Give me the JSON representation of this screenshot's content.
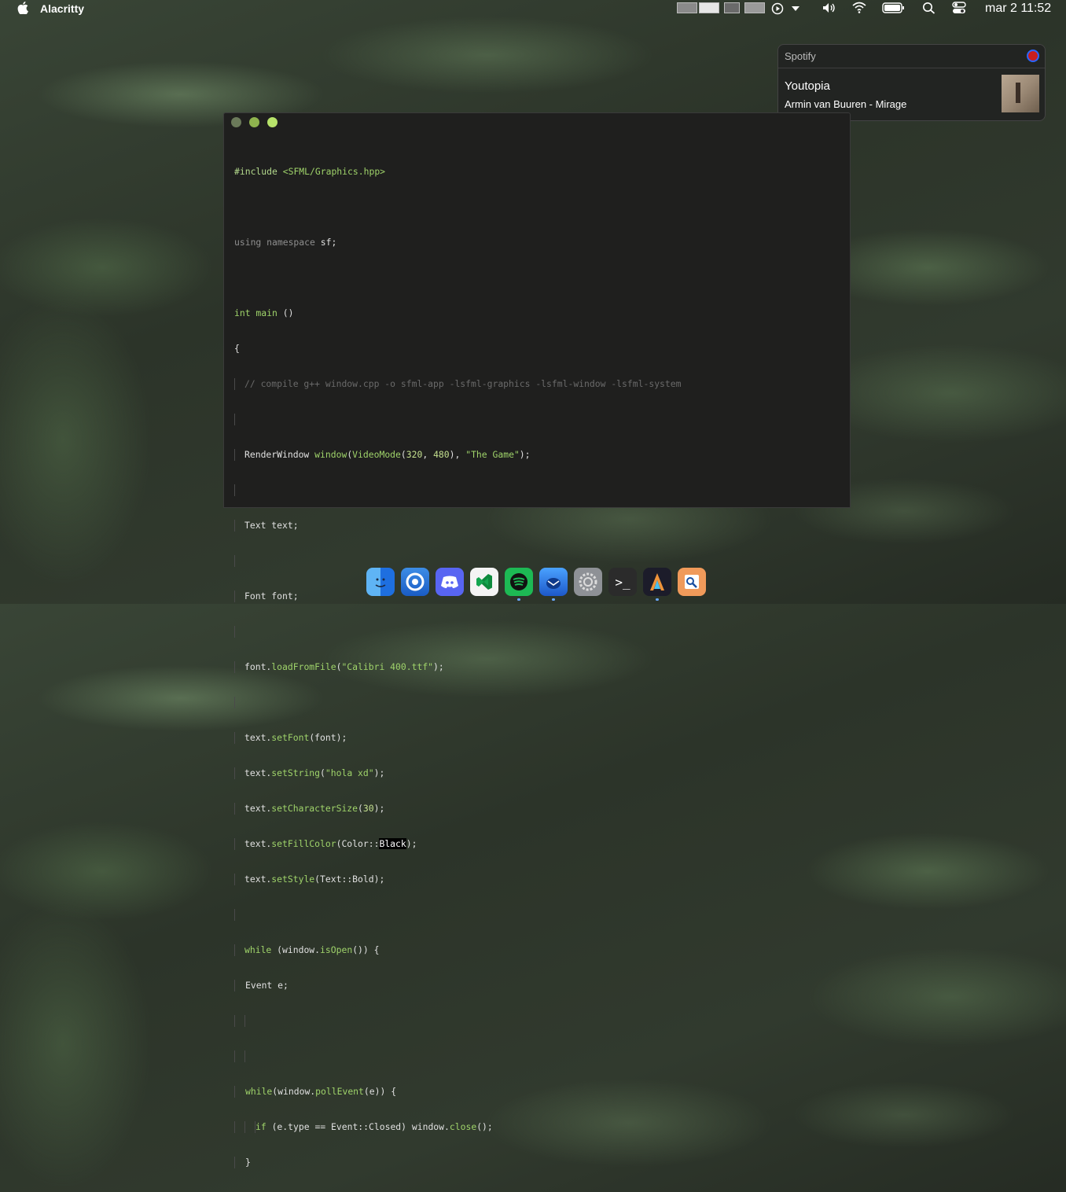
{
  "menubar": {
    "app_name": "Alacritty",
    "clock": "mar 2 11:52"
  },
  "notification": {
    "app": "Spotify",
    "title": "Youtopia",
    "body": "Armin van Buuren - Mirage"
  },
  "terminal": {
    "traffic_colors": [
      "#6b7a5a",
      "#8fb34e",
      "#b7e36a"
    ]
  },
  "code": {
    "l1a": "#include",
    "l1b": " <SFML/Graphics.hpp>",
    "l3a": "using namespace",
    "l3b": " sf;",
    "l5a": "int",
    "l5b": " main",
    "l5c": " ()",
    "l6": "{",
    "l7": "// compile g++ window.cpp -o sfml-app -lsfml-graphics -lsfml-window -lsfml-system",
    "l9a": "RenderWindow ",
    "l9b": "window",
    "l9c": "(",
    "l9d": "VideoMode",
    "l9e": "(",
    "l9f": "320",
    "l9g": ", ",
    "l9h": "480",
    "l9i": "), ",
    "l9j": "\"The Game\"",
    "l9k": ");",
    "l11": "Text text;",
    "l13": "Font font;",
    "l15a": "font.",
    "l15b": "loadFromFile",
    "l15c": "(",
    "l15d": "\"Calibri 400.ttf\"",
    "l15e": ");",
    "l17a": "text.",
    "l17b": "setFont",
    "l17c": "(font);",
    "l18a": "text.",
    "l18b": "setString",
    "l18c": "(",
    "l18d": "\"hola xd\"",
    "l18e": ");",
    "l19a": "text.",
    "l19b": "setCharacterSize",
    "l19c": "(",
    "l19d": "30",
    "l19e": ");",
    "l20a": "text.",
    "l20b": "setFillColor",
    "l20c": "(Color::",
    "l20d": "Black",
    "l20e": ");",
    "l21a": "text.",
    "l21b": "setStyle",
    "l21c": "(Text::Bold);",
    "l23a": "while",
    "l23b": " (window.",
    "l23c": "isOpen",
    "l23d": "()) {",
    "l24": "Event e;",
    "l27a": "while",
    "l27b": "(window.",
    "l27c": "pollEvent",
    "l27d": "(e)) {",
    "l28a": "if",
    "l28b": " (e.type == Event::Closed) window.",
    "l28c": "close",
    "l28d": "();",
    "l29": "}"
  },
  "dock": {
    "apps": [
      "Finder",
      "Chromium",
      "Discord",
      "Visual Studio Code",
      "Spotify",
      "Thunderbird",
      "System Preferences",
      "Terminal",
      "Alacritty",
      "Preview"
    ],
    "terminal_glyph": ">_"
  },
  "colors": {
    "accent_green": "#9fd36a",
    "terminal_bg": "#1f1f1e"
  }
}
